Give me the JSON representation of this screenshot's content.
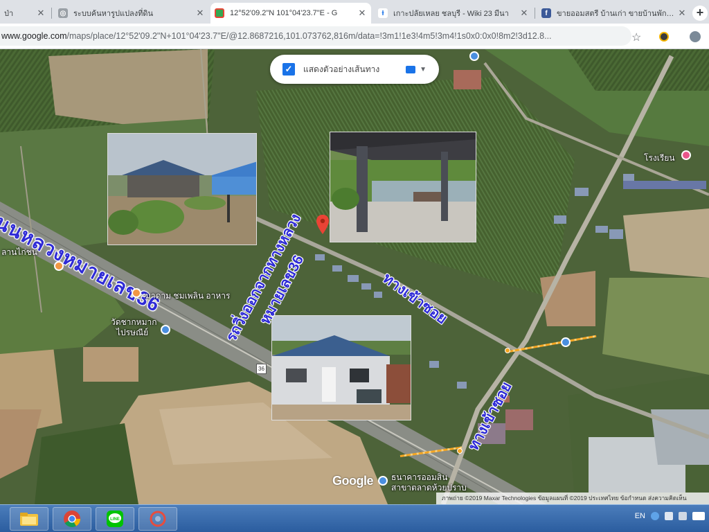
{
  "browser": {
    "tabs": [
      {
        "title": "ป่า",
        "favicon": "web-icon",
        "active": false
      },
      {
        "title": "ระบบค้นหารูปแปลงที่ดิน",
        "favicon": "globe-icon",
        "active": false
      },
      {
        "title": "12°52'09.2\"N 101°04'23.7\"E - G",
        "favicon": "google-maps-icon",
        "active": true
      },
      {
        "title": "เกาะปลัยเหลย ชลบุรี - Wiki 23 มีนา",
        "favicon": "wikipedia-icon",
        "active": false
      },
      {
        "title": "ขายออมสตรี บ้านเก่า ขายบ้านพักคอ...",
        "favicon": "facebook-icon",
        "active": false
      }
    ],
    "url_host": "www.google.com",
    "url_path": "/maps/place/12°52'09.2\"N+101°04'23.7\"E/@12.8687216,101.073762,816m/data=!3m1!1e3!4m5!3m4!1s0x0:0x0!8m2!3d12.8..."
  },
  "map": {
    "layer_chip_label": "แสดงตัวอย่างเส้นทาง",
    "labels": {
      "highway_name": "ถนนหลวงหมายเลข36",
      "road_from_highway": "รถวิ่งออกจากทางหลวง",
      "road_number": "หมายเลข36",
      "entrance_upper": "ทางเข้าซอย",
      "entrance_lower": "ทางเข้าซอย",
      "left_poi": "ลานไก่ชน",
      "poi_restaurant": "มาดาม ชมเพลิน อาหาร",
      "poi_temple_line1": "วัดชากหมาก",
      "poi_temple_line2": "ไปรษณีย์",
      "poi_right": "โรงเรียน",
      "poi_bottom_line1": "ธนาคารออมสิน",
      "poi_bottom_line2": "สาขาตลาดห้วยปราบ",
      "highway_shield": "36"
    },
    "google_logo": "Google",
    "copyright": "ภาพถ่าย ©2019 Maxar Technologies ข้อมูลแผนที่ ©2019   ประเทศไทย   ข้อกำหนด   ส่งความคิดเห็น"
  },
  "taskbar": {
    "apps": [
      "file-explorer-icon",
      "chrome-icon",
      "line-app-icon",
      "app-icon"
    ],
    "language": "EN"
  }
}
